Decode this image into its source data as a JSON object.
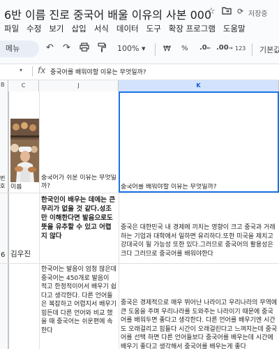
{
  "doc": {
    "title": "6반 이름 진로 중국어 배울 이유의 사본 000",
    "saving": "저장중"
  },
  "menu": [
    "파일",
    "수정",
    "보기",
    "삽입",
    "서식",
    "데이터",
    "도구",
    "확장 프로그램",
    "도움말"
  ],
  "toolbar": {
    "search": "메뉴",
    "zoom": "100%",
    "currency": "₩",
    "percent": "%",
    "dec_less": ".0",
    "dec_more": ".00",
    "number_format": "123",
    "font": "기본값"
  },
  "formula_bar": {
    "fx": "fx",
    "value": "중국어를 배워야할 이유는 무엇일까?"
  },
  "columns": [
    "B",
    "C",
    "J",
    "K"
  ],
  "rows": [
    {
      "b": "번호",
      "c": "이름",
      "j": "중국어가 쉬운 이유는 무엇일까?",
      "k": "중국어를 배워야할 이유는 무엇일까?"
    },
    {
      "b": "6",
      "c": "김우진",
      "j": "한국인이 배우는 데에는 큰 무리가 없을 것 같다.성조만 이해한다면 발음으로도 뜻을 유추할 수 있고 어렵지 않다",
      "k": "중국은 대한민국 내 경제에 끼치는 영향이 크고 중국과 거래하는 기업과 대학에서 일하면 유리하다.또한 미국을 제치고 강대국이 될 가능성 또한 있다.그러므로 중국어의 활용성은 크다 그러므로 중국어를 배워야한다"
    },
    {
      "b": "",
      "c": "",
      "j": "한국어는 발음이 엄청 많은데 중국어는 450개로 발음이 적고 한정적이어서 배우기 쉽다고 생각한다. 다른 언어들은 복잡하고 어렵지서 배우기 힘든데 다른 언어와 비교 했을 때 중국어는 쉬운편에 속한다",
      "k": "중국은 경제적으로 매우 뛰어난 나라이고 우리나라의 무역에 큰 도움을 주며 우리나라를 도와주는 나라이기 때문에 중국어를 배워두면 좋다고 생각한다. 다른 언어를 배우기엔 시간도 오래걸리고 힘들다 시간이 오래걸린다고 느껴지는데 중국어를 선택 하면 다른 언어들보다 중국어를 배우는데 시간에 배우기 좋다고 생각해서 중국어를 배우는게 좋다"
    }
  ]
}
